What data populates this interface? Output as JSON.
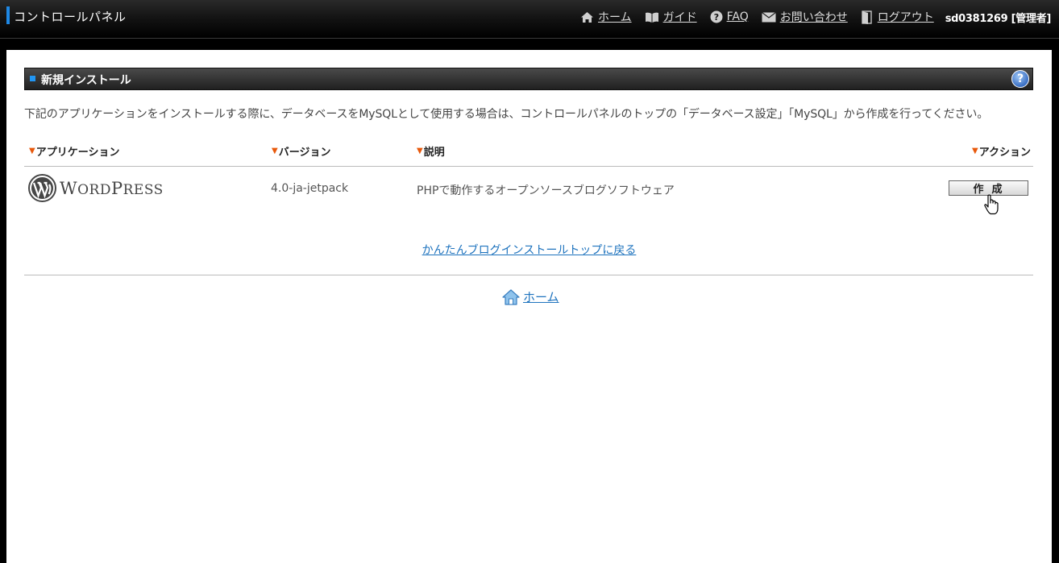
{
  "header": {
    "title": "コントロールパネル",
    "nav": {
      "home": "ホーム",
      "guide": "ガイド",
      "faq": "FAQ",
      "contact": "お問い合わせ",
      "logout": "ログアウト"
    },
    "user": "sd0381269 [管理者]"
  },
  "section": {
    "title": "新規インストール",
    "help": "?"
  },
  "notice": "下記のアプリケーションをインストールする際に、データベースをMySQLとして使用する場合は、コントロールパネルのトップの「データベース設定」「MySQL」から作成を行ってください。",
  "table": {
    "headers": {
      "application": "アプリケーション",
      "version": "バージョン",
      "description": "説明",
      "action": "アクション"
    },
    "rows": [
      {
        "app_logo": [
          "W",
          "ORD",
          "P",
          "RESS"
        ],
        "version": "4.0-ja-jetpack",
        "description": "PHPで動作するオープンソースブログソフトウェア",
        "action": "作成"
      }
    ]
  },
  "links": {
    "back": "かんたんブログインストールトップに戻る",
    "home": "ホーム"
  },
  "colors": {
    "accent": "#1e88e5",
    "link": "#1e73be",
    "triangle": "#e8590c"
  }
}
